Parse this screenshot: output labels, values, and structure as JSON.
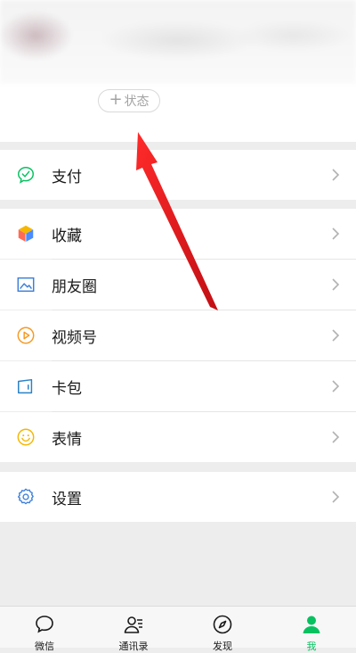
{
  "profile": {
    "status_label": "状态"
  },
  "menu": {
    "pay": "支付",
    "favorites": "收藏",
    "moments": "朋友圈",
    "channels": "视频号",
    "cards": "卡包",
    "stickers": "表情",
    "settings": "设置"
  },
  "tabbar": {
    "chats": "微信",
    "contacts": "通讯录",
    "discover": "发现",
    "me": "我"
  },
  "colors": {
    "accent": "#07c160",
    "annotation_arrow": "#e8141b"
  }
}
